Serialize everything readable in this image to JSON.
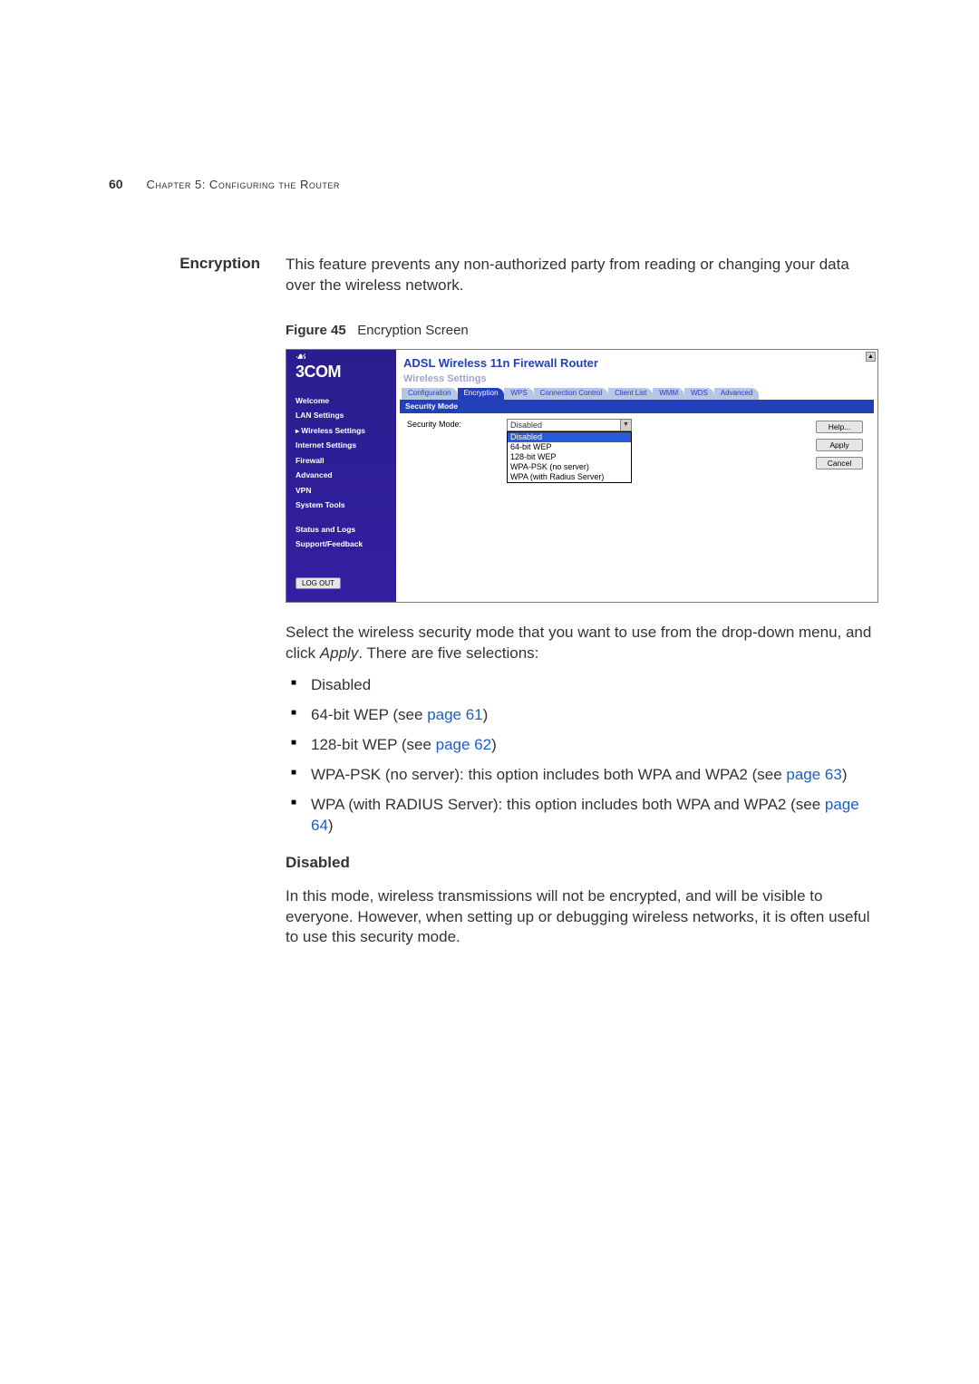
{
  "header": {
    "page_number": "60",
    "chapter_label": "Chapter 5: Configuring the Router"
  },
  "section": {
    "side_heading": "Encryption",
    "intro": "This feature prevents any non-authorized party from reading or changing your data over the wireless network."
  },
  "figure": {
    "label": "Figure 45",
    "title": "Encryption Screen"
  },
  "router": {
    "logo_glyph": "☙",
    "brand": "3COM",
    "product_title": "ADSL Wireless 11n Firewall Router",
    "breadcrumb_sub": "Wireless Settings",
    "tabs": [
      "Configuration",
      "Encryption",
      "WPS",
      "Connection Control",
      "Client List",
      "WMM",
      "WDS",
      "Advanced"
    ],
    "nav": [
      "Welcome",
      "LAN Settings",
      "Wireless Settings",
      "Internet Settings",
      "Firewall",
      "Advanced",
      "VPN",
      "System Tools"
    ],
    "nav_group2": [
      "Status and Logs",
      "Support/Feedback"
    ],
    "logout": "LOG OUT",
    "section_header": "Security Mode",
    "form_label": "Security Mode:",
    "selected_value": "Disabled",
    "options": [
      "Disabled",
      "64-bit WEP",
      "128-bit WEP",
      "WPA-PSK (no server)",
      "WPA (with Radius Server)"
    ],
    "buttons": {
      "help": "Help...",
      "apply": "Apply",
      "cancel": "Cancel"
    }
  },
  "post_figure": {
    "p1a": "Select the wireless security mode that you want to use from the drop-down menu, and click ",
    "p1_em": "Apply",
    "p1b": ". There are five selections:",
    "bullets": {
      "b1": "Disabled",
      "b2a": "64-bit WEP (see ",
      "b2link": "page 61",
      "b2b": ")",
      "b3a": "128-bit WEP (see ",
      "b3link": "page 62",
      "b3b": ")",
      "b4a": "WPA-PSK (no server): this option includes both WPA and WPA2 (see ",
      "b4link": "page 63",
      "b4b": ")",
      "b5a": "WPA (with RADIUS Server): this option includes both WPA and WPA2 (see ",
      "b5link": "page 64",
      "b5b": ")"
    },
    "sub_h": "Disabled",
    "sub_p": "In this mode, wireless transmissions will not be encrypted, and will be visible to everyone. However, when setting up or debugging wireless networks, it is often useful to use this security mode."
  }
}
